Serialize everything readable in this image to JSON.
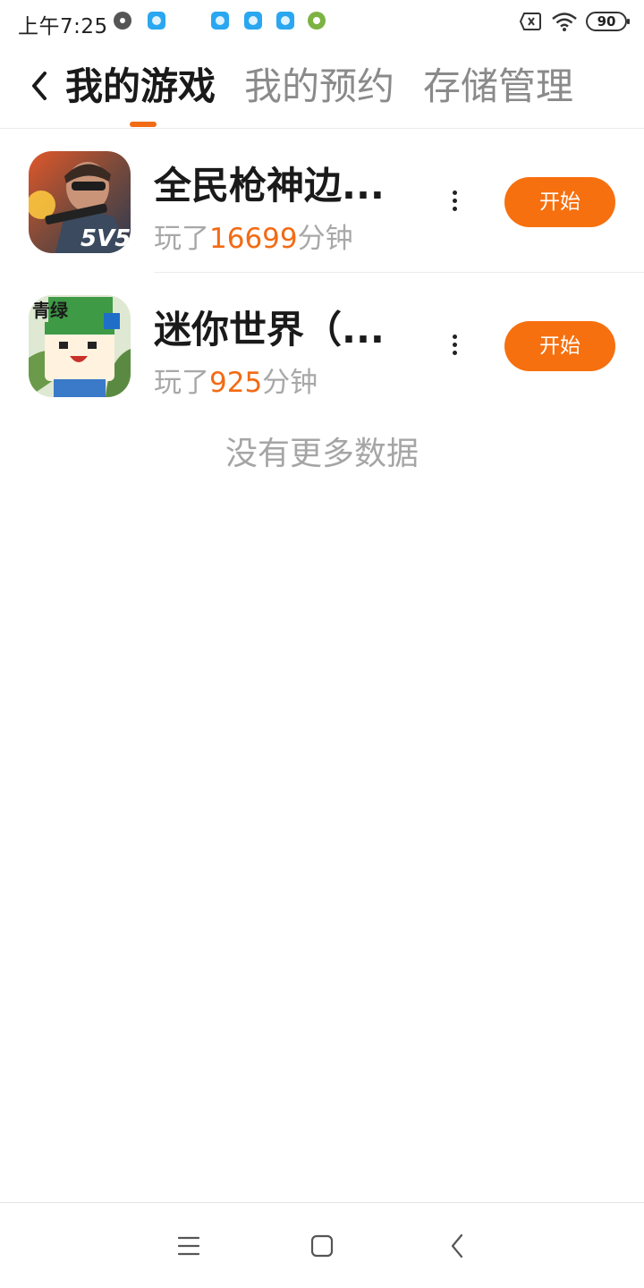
{
  "status_bar": {
    "time": "上午7:25",
    "battery": "90",
    "icons": [
      "media-disc-icon",
      "app-notification-icon",
      "app-notification-icon",
      "app-notification-icon",
      "app-notification-icon",
      "settings-notification-icon",
      "no-sim-icon",
      "wifi-icon",
      "battery-icon"
    ]
  },
  "header": {
    "back_icon": "chevron-left-icon",
    "tabs": [
      {
        "label": "我的游戏",
        "active": true
      },
      {
        "label": "我的预约",
        "active": false
      },
      {
        "label": "存储管理",
        "active": false
      }
    ],
    "accent_color": "#f26b15"
  },
  "games": [
    {
      "title": "全民枪神边...",
      "played_prefix": "玩了",
      "minutes": "16699",
      "played_suffix": "分钟",
      "start_label": "开始",
      "icon": "shooter-game-icon"
    },
    {
      "title": "迷你世界（...",
      "played_prefix": "玩了",
      "minutes": "925",
      "played_suffix": "分钟",
      "start_label": "开始",
      "icon": "mini-world-game-icon"
    }
  ],
  "empty_text": "没有更多数据",
  "nav_bar": {
    "icons": [
      "menu-icon",
      "home-icon",
      "back-icon"
    ]
  }
}
